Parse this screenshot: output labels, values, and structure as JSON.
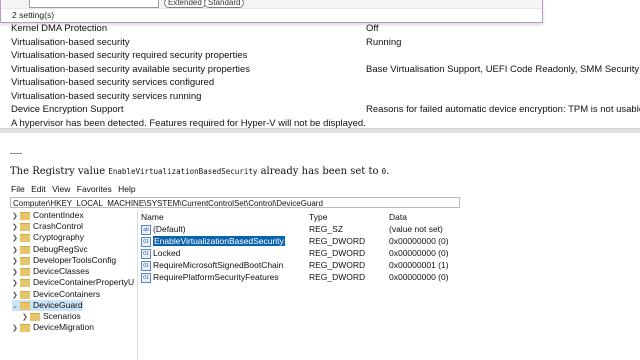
{
  "settings_window": {
    "pill_extended": "Extended",
    "pill_standard": "Standard",
    "setting_count": "2 setting(s)"
  },
  "system_info": {
    "rows": [
      {
        "label": "Kernel DMA Protection",
        "value": "Off"
      },
      {
        "label": "Virtualisation-based security",
        "value": "Running"
      },
      {
        "label": "Virtualisation-based security required security properties",
        "value": ""
      },
      {
        "label": "Virtualisation-based security available security properties",
        "value": "Base Virtualisation Support, UEFI Code Readonly, SMM Security Mitiga"
      },
      {
        "label": "Virtualisation-based security services configured",
        "value": ""
      },
      {
        "label": "Virtualisation-based security services running",
        "value": ""
      },
      {
        "label": "Device Encryption Support",
        "value": "Reasons for failed automatic device encryption: TPM is not usable, PCR"
      },
      {
        "label": "A hypervisor has been detected. Features required for Hyper-V will not be displayed.",
        "value": ""
      }
    ]
  },
  "post": {
    "separator": "----",
    "text_before": "The Registry value",
    "code_value_name": "EnableVirtualizationBasedSecurity",
    "text_middle": "already has been set to",
    "code_value": "0",
    "text_after": "."
  },
  "regedit": {
    "menu": [
      "File",
      "Edit",
      "View",
      "Favorites",
      "Help"
    ],
    "address": "Computer\\HKEY_LOCAL_MACHINE\\SYSTEM\\CurrentControlSet\\Control\\DeviceGuard",
    "tree": [
      {
        "label": "ContentIndex"
      },
      {
        "label": "CrashControl"
      },
      {
        "label": "Cryptography"
      },
      {
        "label": "DebugRegSvc"
      },
      {
        "label": "DeveloperToolsConfig"
      },
      {
        "label": "DeviceClasses"
      },
      {
        "label": "DeviceContainerPropertyU"
      },
      {
        "label": "DeviceContainers"
      },
      {
        "label": "DeviceGuard",
        "selected": true
      },
      {
        "label": "Scenarios"
      },
      {
        "label": "DeviceMigration"
      }
    ],
    "columns": {
      "name": "Name",
      "type": "Type",
      "data": "Data"
    },
    "values": [
      {
        "icon": "ab",
        "name": "(Default)",
        "type": "REG_SZ",
        "data": "(value not set)"
      },
      {
        "icon": "01",
        "name": "EnableVirtualizationBasedSecurity",
        "type": "REG_DWORD",
        "data": "0x00000000 (0)",
        "selected": true
      },
      {
        "icon": "01",
        "name": "Locked",
        "type": "REG_DWORD",
        "data": "0x00000000 (0)"
      },
      {
        "icon": "01",
        "name": "RequireMicrosoftSignedBootChain",
        "type": "REG_DWORD",
        "data": "0x00000001 (1)"
      },
      {
        "icon": "01",
        "name": "RequirePlatformSecurityFeatures",
        "type": "REG_DWORD",
        "data": "0x00000000 (0)"
      }
    ]
  }
}
